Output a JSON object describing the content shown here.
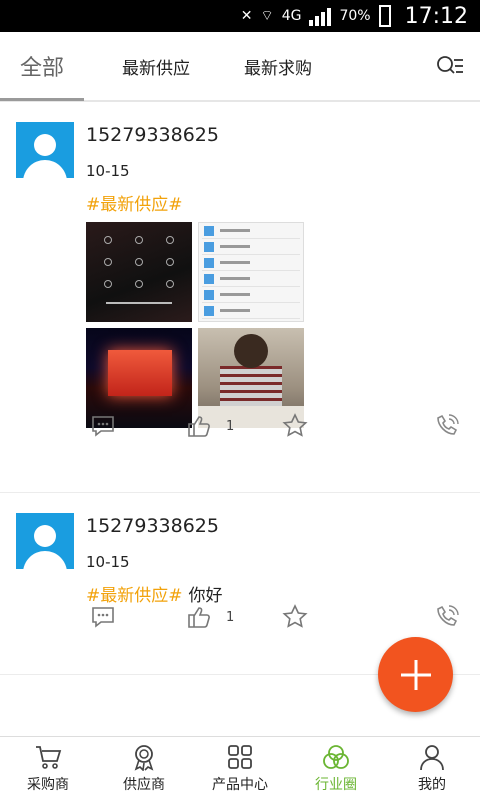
{
  "status_bar": {
    "battery": "70%",
    "network": "4G",
    "time": "17:12"
  },
  "tabs": [
    {
      "label": "全部",
      "active": true
    },
    {
      "label": "最新供应",
      "active": false
    },
    {
      "label": "最新求购",
      "active": false
    }
  ],
  "posts": [
    {
      "username": "15279338625",
      "date": "10-15",
      "tag": "#最新供应#",
      "message": "",
      "image_count": 4,
      "likes": "1"
    },
    {
      "username": "15279338625",
      "date": "10-15",
      "tag": "#最新供应#",
      "message": "你好",
      "image_count": 0,
      "likes": "1"
    }
  ],
  "bottom_nav": [
    {
      "label": "采购商",
      "icon": "cart-icon"
    },
    {
      "label": "供应商",
      "icon": "medal-icon"
    },
    {
      "label": "产品中心",
      "icon": "grid-icon"
    },
    {
      "label": "行业圈",
      "icon": "circles-icon",
      "active": true
    },
    {
      "label": "我的",
      "icon": "person-icon"
    }
  ],
  "colors": {
    "accent_orange": "#f2541f",
    "tag_color": "#f2a20b",
    "active_nav": "#6ab532",
    "avatar_blue": "#1a9de0"
  }
}
